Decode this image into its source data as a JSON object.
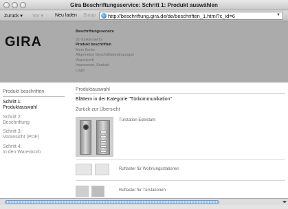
{
  "window": {
    "title": "Gira Beschriftungsservice: Schritt 1: Produkt auswählen"
  },
  "toolbar": {
    "back": "Zurück",
    "forward": "Vor",
    "reload": "Neu laden",
    "stop": "Stopp",
    "url": "http://beschriftung.gira.de/de/beschriften_1.html?c_id=6"
  },
  "header": {
    "logo": "GIRA",
    "nav_heading": "Beschriftungsservice",
    "nav": [
      "So funktioniert's",
      "Produkt beschriften",
      "Mein Konto",
      "Allgemeine Geschäftsbedingungen",
      "Warenkorb",
      "Impressum, Kontakt",
      "Login"
    ]
  },
  "sidebar": {
    "heading": "Produkt beschriften",
    "steps": [
      {
        "label": "Schritt 1:",
        "name": "Produktauswahl"
      },
      {
        "label": "Schritt 2:",
        "name": "Beschriftung"
      },
      {
        "label": "Schritt 3:",
        "name": "Voransicht (PDF)"
      },
      {
        "label": "Schritt 4:",
        "name": "In den Warenkorb"
      }
    ]
  },
  "main": {
    "heading": "Produktauswahl",
    "category_line": "Blättern in der Kategorie \"Türkommunikation\"",
    "back_link": "Zurück zur Übersicht",
    "products": [
      "Türstation Edelstahl",
      "Ruftaster für Wohnungsstationen",
      "Ruftaster für Türstationen"
    ]
  }
}
